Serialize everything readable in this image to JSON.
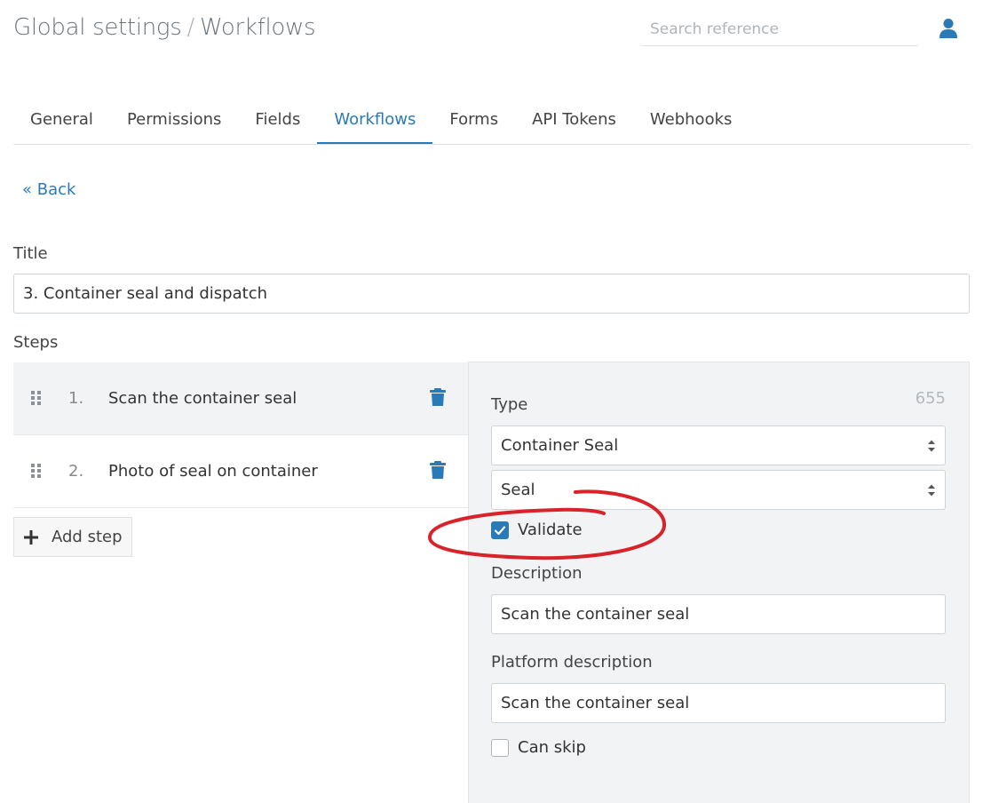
{
  "header": {
    "breadcrumb_root": "Global settings",
    "breadcrumb_separator": "/",
    "breadcrumb_current": "Workflows",
    "search_placeholder": "Search reference",
    "user_icon": "user-icon"
  },
  "tabs": [
    {
      "label": "General",
      "active": false
    },
    {
      "label": "Permissions",
      "active": false
    },
    {
      "label": "Fields",
      "active": false
    },
    {
      "label": "Workflows",
      "active": true
    },
    {
      "label": "Forms",
      "active": false
    },
    {
      "label": "API Tokens",
      "active": false
    },
    {
      "label": "Webhooks",
      "active": false
    }
  ],
  "back_link": "« Back",
  "form": {
    "title_label": "Title",
    "title_value": "3. Container seal and dispatch",
    "steps_label": "Steps",
    "steps": [
      {
        "number": "1.",
        "name": "Scan the container seal",
        "active": true
      },
      {
        "number": "2.",
        "name": "Photo of seal on container",
        "active": false
      }
    ],
    "add_step_label": "Add step"
  },
  "step_detail": {
    "id": "655",
    "type_label": "Type",
    "type_value": "Container Seal",
    "subtype_value": "Seal",
    "validate_label": "Validate",
    "validate_checked": true,
    "description_label": "Description",
    "description_value": "Scan the container seal",
    "platform_description_label": "Platform description",
    "platform_description_value": "Scan the container seal",
    "can_skip_label": "Can skip",
    "can_skip_checked": false
  },
  "colors": {
    "accent": "#2a7ab8",
    "annotation": "#d8232a",
    "panel_bg": "#f2f3f4"
  }
}
